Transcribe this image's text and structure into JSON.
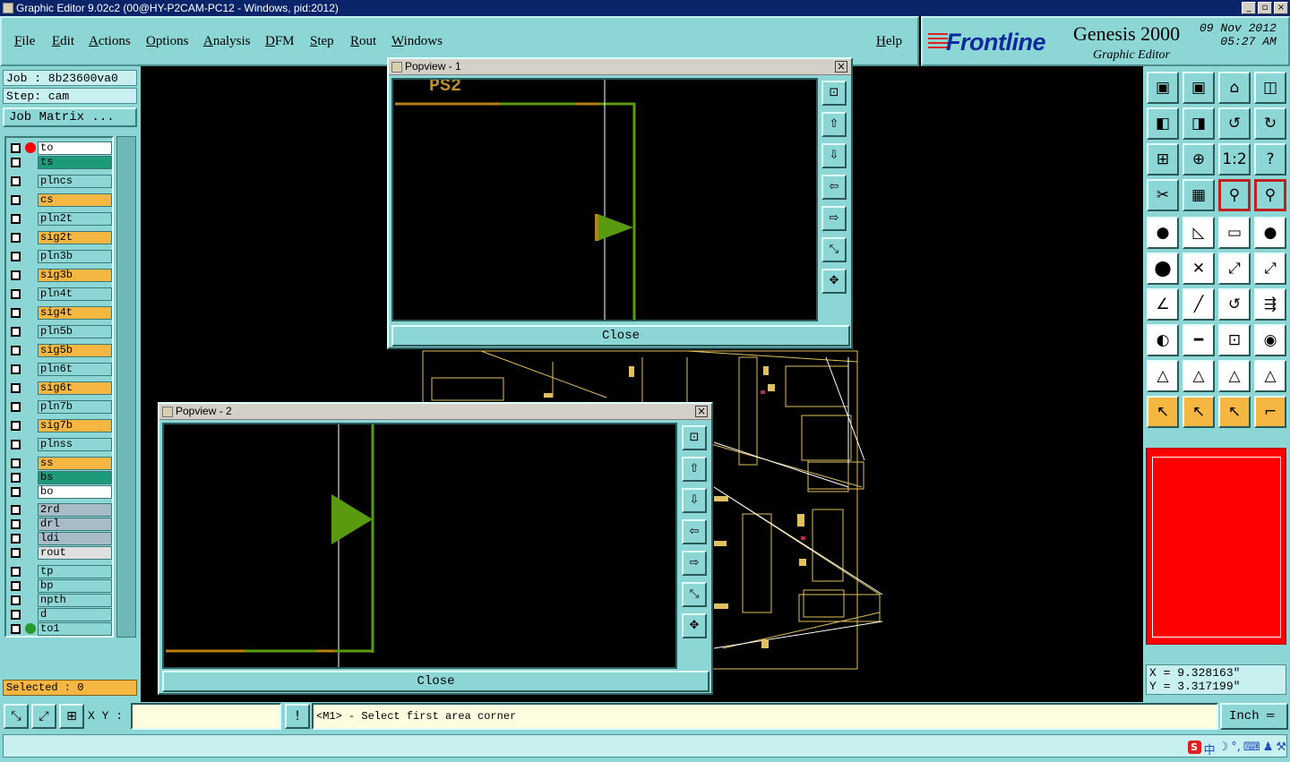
{
  "window": {
    "title": "Graphic Editor 9.02c2 (00@HY-P2CAM-PC12 - Windows, pid:2012)",
    "min": "_",
    "max": "▫",
    "close": "×"
  },
  "menu": [
    {
      "label": "File"
    },
    {
      "label": "Edit"
    },
    {
      "label": "Actions"
    },
    {
      "label": "Options"
    },
    {
      "label": "Analysis"
    },
    {
      "label": "DFM"
    },
    {
      "label": "Step"
    },
    {
      "label": "Rout"
    },
    {
      "label": "Windows"
    }
  ],
  "help_label": "Help",
  "brand": {
    "logo": "Frontline",
    "product": "Genesis 2000",
    "subtitle": "Graphic Editor",
    "date": "09 Nov 2012",
    "time": "05:27 AM"
  },
  "job": {
    "job_line": "Job : 8b23600va0",
    "step_line": "Step: cam",
    "matrix_button": "Job Matrix ..."
  },
  "layers": [
    {
      "name": "to",
      "color": "#ffffff"
    },
    {
      "name": "ts",
      "color": "#1c9a7a"
    },
    {
      "name": "plncs",
      "color": "#8dd6d6"
    },
    {
      "name": "cs",
      "color": "#f5b642"
    },
    {
      "name": "pln2t",
      "color": "#8dd6d6"
    },
    {
      "name": "sig2t",
      "color": "#f5b642"
    },
    {
      "name": "pln3b",
      "color": "#8dd6d6"
    },
    {
      "name": "sig3b",
      "color": "#f5b642"
    },
    {
      "name": "pln4t",
      "color": "#8dd6d6"
    },
    {
      "name": "sig4t",
      "color": "#f5b642"
    },
    {
      "name": "pln5b",
      "color": "#8dd6d6"
    },
    {
      "name": "sig5b",
      "color": "#f5b642"
    },
    {
      "name": "pln6t",
      "color": "#8dd6d6"
    },
    {
      "name": "sig6t",
      "color": "#f5b642"
    },
    {
      "name": "pln7b",
      "color": "#8dd6d6"
    },
    {
      "name": "sig7b",
      "color": "#f5b642"
    },
    {
      "name": "plnss",
      "color": "#8dd6d6"
    },
    {
      "name": "ss",
      "color": "#f5b642"
    },
    {
      "name": "bs",
      "color": "#1c9a7a"
    },
    {
      "name": "bo",
      "color": "#ffffff"
    },
    {
      "name": "2rd",
      "color": "#a8bcc8"
    },
    {
      "name": "drl",
      "color": "#a8bcc8"
    },
    {
      "name": "ldi",
      "color": "#a8bcc8"
    },
    {
      "name": "rout",
      "color": "#e0e0e0"
    },
    {
      "name": "tp",
      "color": "#8dd6d6"
    },
    {
      "name": "bp",
      "color": "#8dd6d6"
    },
    {
      "name": "npth",
      "color": "#8dd6d6"
    },
    {
      "name": "d",
      "color": "#8dd6d6"
    },
    {
      "name": "to1",
      "color": "#8dd6d6"
    }
  ],
  "selected_text": "Selected : 0",
  "coords": {
    "x": "X = 9.328163\"",
    "y": "Y = 3.317199\""
  },
  "bottom": {
    "xy_label": "X Y :",
    "xy_value": "",
    "bang": "!",
    "message": "<M1> - Select first area corner",
    "unit": "Inch ═"
  },
  "popup1": {
    "title": "Popview - 1",
    "close_label": "Close",
    "x_label": "×",
    "label": "PS2"
  },
  "popup2": {
    "title": "Popview - 2",
    "close_label": "Close",
    "x_label": "×"
  },
  "icons": {
    "tb": [
      "▣",
      "▣",
      "⌂",
      "◫",
      "◧",
      "◨",
      "↺",
      "↻",
      "⊞",
      "⊕",
      "1:2",
      "?",
      "✂",
      "▦",
      "⚲",
      "⚲",
      "●",
      "◺",
      "▭",
      "●",
      "⬤",
      "✕",
      "⤢",
      "⤢",
      "∠",
      "╱",
      "↺",
      "⇶",
      "◐",
      "━",
      "⊡",
      "◉",
      "△",
      "△",
      "△",
      "△",
      "↖",
      "↖",
      "↖",
      "⌐"
    ],
    "pside": [
      "⊡",
      "⇧",
      "⇩",
      "⇦",
      "⇨",
      "⤡",
      "✥"
    ],
    "bottom": [
      "⤡",
      "⤢",
      "⊞"
    ]
  },
  "colors": {
    "panel": "#8dd6d6",
    "accent_orange": "#f5b642",
    "teal": "#1c9a7a",
    "trace_green": "#5a9a10",
    "trace_orange": "#b88010",
    "board_yellow": "#e0c060"
  }
}
